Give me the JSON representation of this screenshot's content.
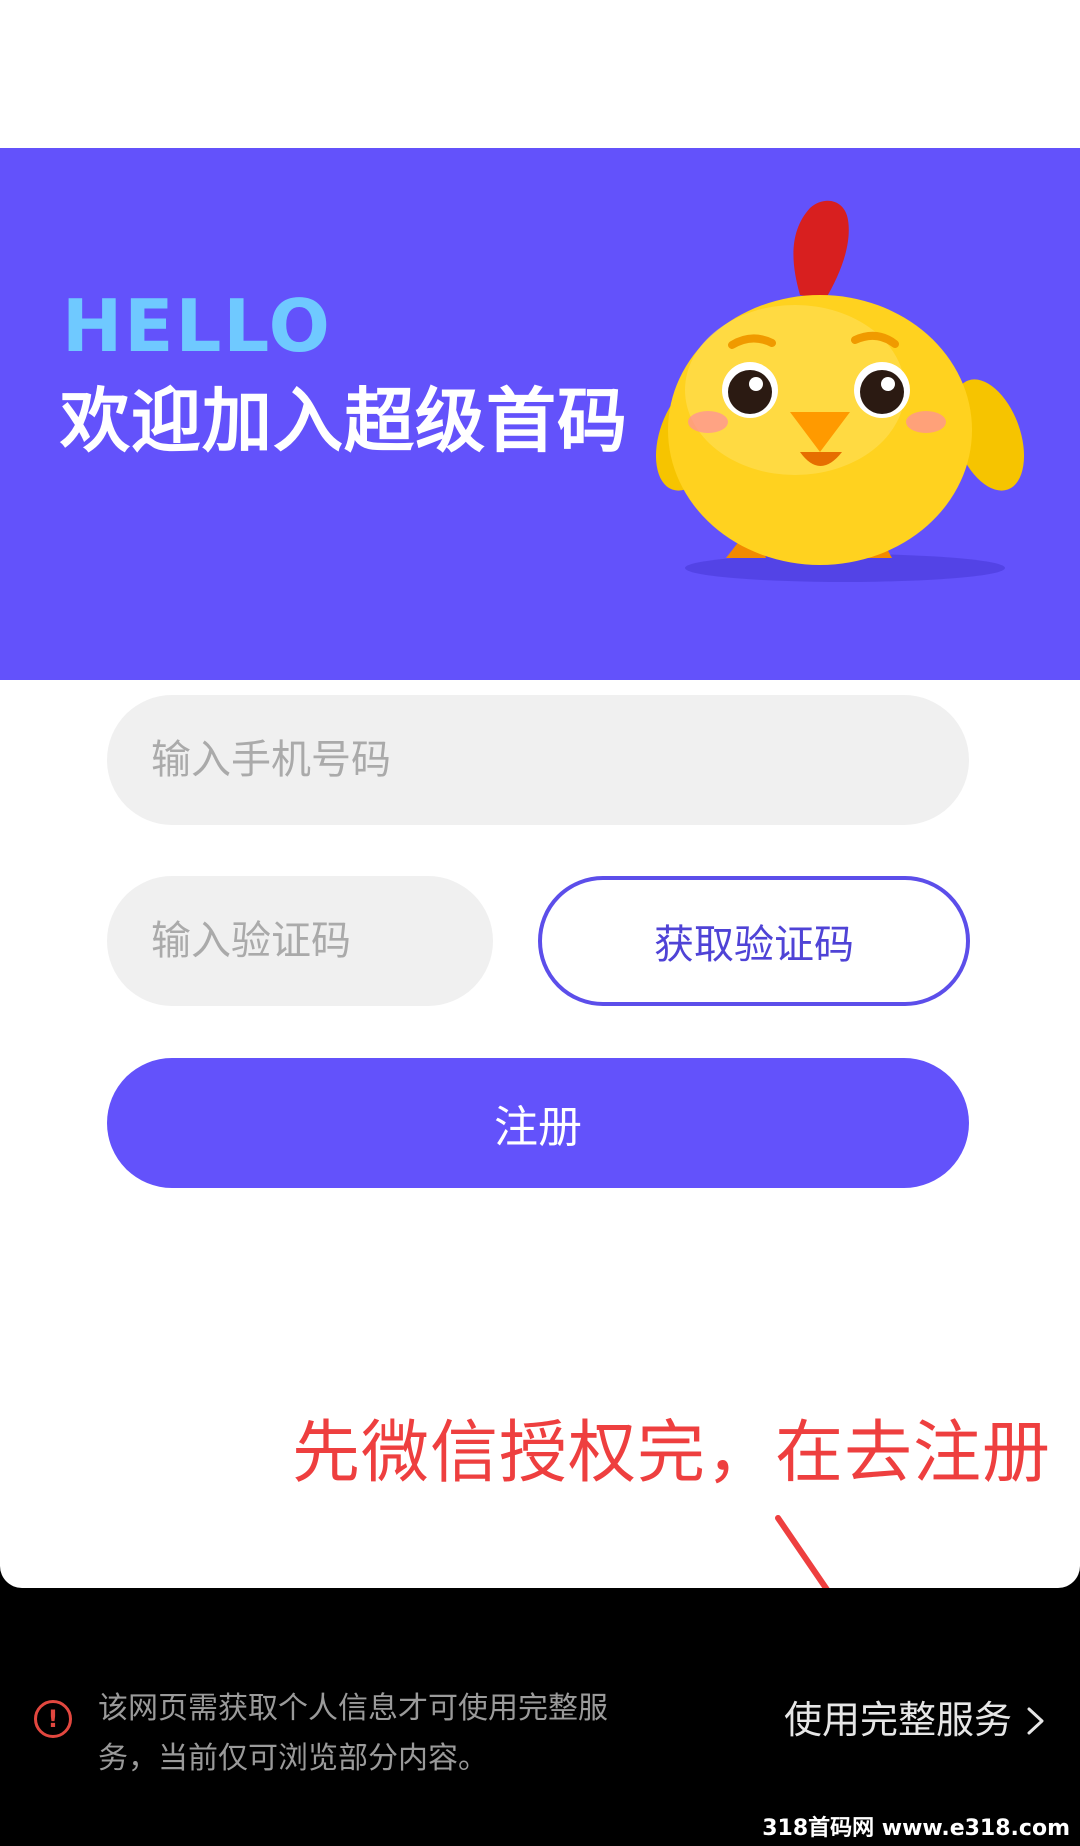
{
  "banner": {
    "hello": "HELLO",
    "welcome": "欢迎加入超级首码",
    "colors": {
      "background": "#6352fb",
      "hello": "#6fc9ff"
    }
  },
  "form": {
    "phone_placeholder": "输入手机号码",
    "code_placeholder": "输入验证码",
    "get_code_label": "获取验证码",
    "register_label": "注册"
  },
  "annotation": {
    "text": "先微信授权完，在去注册",
    "color": "#ee3f3f"
  },
  "bottom_bar": {
    "notice": "该网页需获取个人信息才可使用完整服务，当前仅可浏览部分内容。",
    "full_service_label": "使用完整服务",
    "icon": "alert-circle-icon"
  },
  "watermark": "318首码网 www.e318.com"
}
